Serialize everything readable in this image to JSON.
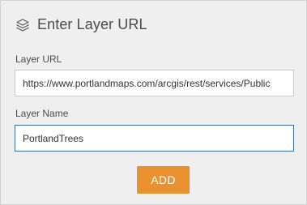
{
  "header": {
    "icon": "layers-icon",
    "title": "Enter Layer URL"
  },
  "form": {
    "url_label": "Layer URL",
    "url_value": "https://www.portlandmaps.com/arcgis/rest/services/Public",
    "name_label": "Layer Name",
    "name_value": "PortlandTrees"
  },
  "actions": {
    "add_label": "ADD"
  },
  "colors": {
    "panel_background": "#efefef",
    "accent_button": "#e8912e",
    "focused_border": "#3a6ea5",
    "text": "#4c4c4c"
  }
}
